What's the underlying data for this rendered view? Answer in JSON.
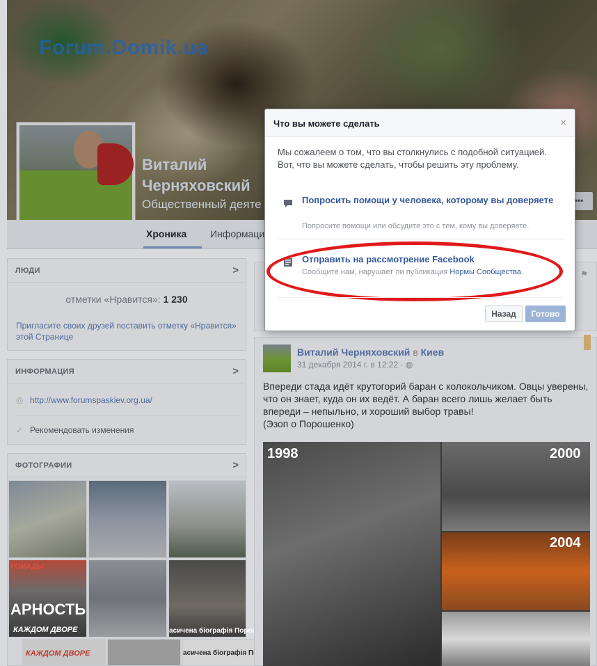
{
  "cover": {
    "watermark": "Forum.Domik.ua",
    "name_line1": "Виталий",
    "name_line2": "Черняховский",
    "subtitle": "Общественный деяте",
    "more_label": "•••"
  },
  "tabs": [
    {
      "label": "Хроника",
      "active": true
    },
    {
      "label": "Информация",
      "active": false
    }
  ],
  "people": {
    "title": "ЛЮДИ",
    "likes_prefix": "отметки «Нравится»:",
    "likes_count": "1 230",
    "invite_text": "Пригласите своих друзей поставить отметку «Нравится» этой Странице"
  },
  "info": {
    "title": "ИНФОРМАЦИЯ",
    "website": "http://www.forumspaskiev.org.ua/",
    "suggest_edits": "Рекомендовать изменения"
  },
  "photos": {
    "title": "ФОТОГРАФИИ",
    "caption_1": "РОМАДЫ",
    "caption_2": "АРНОСТЬ",
    "caption_3": "КАЖДОМ ДВОРЕ",
    "caption_4": "асичена біографія Порошен",
    "caption_5": "КАЖДОМ ДВОРЕ",
    "caption_6": "асичена біографія Порошен"
  },
  "post": {
    "author": "Виталий Черняховский",
    "location_pre": "в",
    "location": "Киев",
    "date": "31 декабря 2014 г. в 12:22 ·",
    "text": "Впереди стада идёт крутогорий баран с колокольчиком. Овцы уверены, что он знает, куда он их ведёт. А баран все­го лишь желает быть впереди – непыльно, и хороший выбор травы!",
    "text2": "(Эзоп о Порошенко)",
    "years": [
      "1998",
      "2000",
      "2004"
    ]
  },
  "dialog": {
    "title": "Что вы можете сделать",
    "close": "×",
    "intro": "Мы сожалеем о том, что вы столкнулись с подобной ситуацией. Вот, что вы можете сделать, чтобы решить эту проблему.",
    "option1_title": "Попросить помощи у человека, которому вы доверяете",
    "option1_desc": "Попросите помощи или обсудите это с тем, кому вы доверяете.",
    "option2_title": "Отправить на рассмотрение Facebook",
    "option2_desc_pre": "Сообщите нам, нарушает ли публикация",
    "option2_desc_link": "Нормы Сообщества",
    "option2_desc_post": ".",
    "back_label": "Назад",
    "done_label": "Готово"
  },
  "colors": {
    "link": "#365899",
    "highlight": "#e01a1a",
    "done_button": "#9cb4d8"
  }
}
